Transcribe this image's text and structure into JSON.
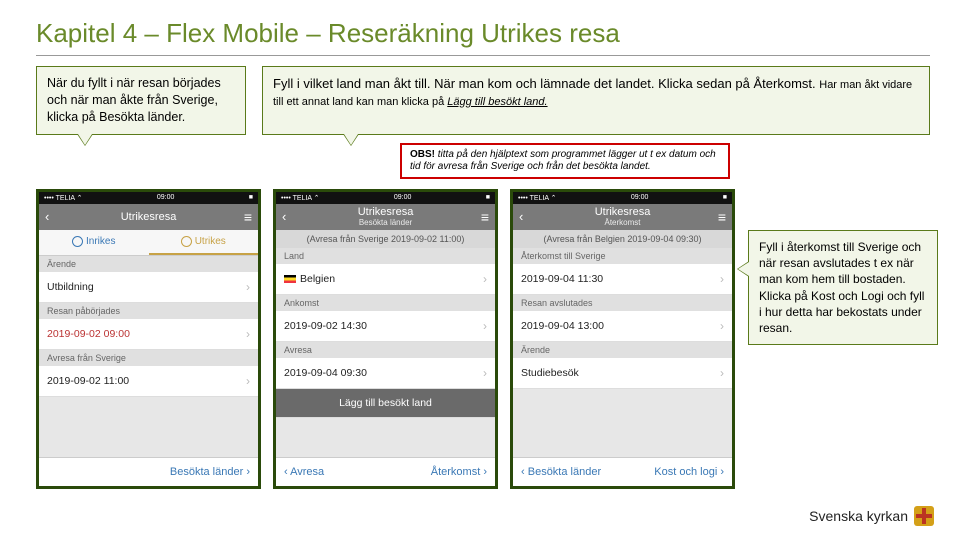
{
  "title": "Kapitel 4 – Flex Mobile – Reseräkning Utrikes resa",
  "callouts": {
    "c1": "När du fyllt i när resan börjades och när man åkte från Sverige, klicka på Besökta länder.",
    "c2_a": "Fyll i vilket land man åkt till. När man kom och lämnade det landet. Klicka sedan på Återkomst. ",
    "c2_b": "Har man åkt vidare till ett annat land kan man klicka på ",
    "c2_c": "Lägg till besökt land.",
    "c3": "Fyll i återkomst till Sverige och när resan avslutades t ex när man kom hem till bostaden.\nKlicka på Kost och Logi och fyll i hur detta har bekostats under resan.",
    "obs_b": "OBS!",
    "obs": " titta på den hjälptext som programmet lägger ut t ex datum och tid för avresa från Sverige och från det besökta landet."
  },
  "status": {
    "carrier": "•••• TELIA ⌃",
    "time": "09:00",
    "batt": "■"
  },
  "phone1": {
    "title": "Utrikesresa",
    "tab1": "Inrikes",
    "tab2": "Utrikes",
    "sec1": "Ärende",
    "val1": "Utbildning",
    "sec2": "Resan påbörjades",
    "val2": "2019-09-02 09:00",
    "sec3": "Avresa från Sverige",
    "val3": "2019-09-02 11:00",
    "footer": "Besökta länder"
  },
  "phone2": {
    "title": "Utrikesresa",
    "sub": "Besökta länder",
    "hint": "(Avresa från Sverige 2019-09-02 11:00)",
    "sec1": "Land",
    "val1": "Belgien",
    "sec2": "Ankomst",
    "val2": "2019-09-02 14:30",
    "sec3": "Avresa",
    "val3": "2019-09-04 09:30",
    "add": "Lägg till besökt land",
    "foot_l": "Avresa",
    "foot_r": "Återkomst"
  },
  "phone3": {
    "title": "Utrikesresa",
    "sub": "Återkomst",
    "hint": "(Avresa från Belgien 2019-09-04 09:30)",
    "sec1": "Återkomst till Sverige",
    "val1": "2019-09-04 11:30",
    "sec2": "Resan avslutades",
    "val2": "2019-09-04 13:00",
    "sec3": "Ärende",
    "val3": "Studiebesök",
    "foot_l": "Besökta länder",
    "foot_r": "Kost och logi"
  },
  "logo": "Svenska kyrkan"
}
